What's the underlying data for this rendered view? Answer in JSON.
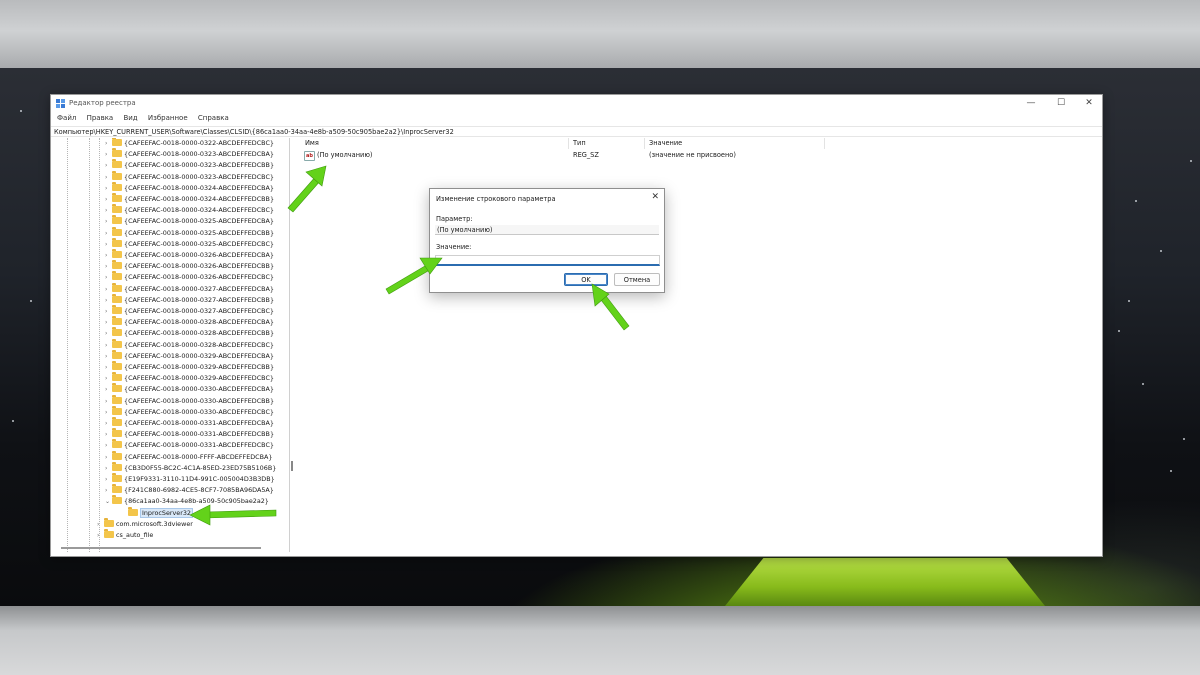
{
  "window": {
    "title": "Редактор реестра",
    "controls": {
      "minimize": "—",
      "maximize": "☐",
      "close": "✕"
    }
  },
  "menu": [
    "Файл",
    "Правка",
    "Вид",
    "Избранное",
    "Справка"
  ],
  "address": "Компьютер\\HKEY_CURRENT_USER\\Software\\Classes\\CLSID\\{86ca1aa0-34aa-4e8b-a509-50c905bae2a2}\\InprocServer32",
  "tree": {
    "items": [
      {
        "label": "{CAFEEFAC-0018-0000-0322-ABCDEFFEDCBC}",
        "level": 2,
        "expander": "›"
      },
      {
        "label": "{CAFEEFAC-0018-0000-0323-ABCDEFFEDCBA}",
        "level": 2,
        "expander": "›"
      },
      {
        "label": "{CAFEEFAC-0018-0000-0323-ABCDEFFEDCBB}",
        "level": 2,
        "expander": "›"
      },
      {
        "label": "{CAFEEFAC-0018-0000-0323-ABCDEFFEDCBC}",
        "level": 2,
        "expander": "›"
      },
      {
        "label": "{CAFEEFAC-0018-0000-0324-ABCDEFFEDCBA}",
        "level": 2,
        "expander": "›"
      },
      {
        "label": "{CAFEEFAC-0018-0000-0324-ABCDEFFEDCBB}",
        "level": 2,
        "expander": "›"
      },
      {
        "label": "{CAFEEFAC-0018-0000-0324-ABCDEFFEDCBC}",
        "level": 2,
        "expander": "›"
      },
      {
        "label": "{CAFEEFAC-0018-0000-0325-ABCDEFFEDCBA}",
        "level": 2,
        "expander": "›"
      },
      {
        "label": "{CAFEEFAC-0018-0000-0325-ABCDEFFEDCBB}",
        "level": 2,
        "expander": "›"
      },
      {
        "label": "{CAFEEFAC-0018-0000-0325-ABCDEFFEDCBC}",
        "level": 2,
        "expander": "›"
      },
      {
        "label": "{CAFEEFAC-0018-0000-0326-ABCDEFFEDCBA}",
        "level": 2,
        "expander": "›"
      },
      {
        "label": "{CAFEEFAC-0018-0000-0326-ABCDEFFEDCBB}",
        "level": 2,
        "expander": "›"
      },
      {
        "label": "{CAFEEFAC-0018-0000-0326-ABCDEFFEDCBC}",
        "level": 2,
        "expander": "›"
      },
      {
        "label": "{CAFEEFAC-0018-0000-0327-ABCDEFFEDCBA}",
        "level": 2,
        "expander": "›"
      },
      {
        "label": "{CAFEEFAC-0018-0000-0327-ABCDEFFEDCBB}",
        "level": 2,
        "expander": "›"
      },
      {
        "label": "{CAFEEFAC-0018-0000-0327-ABCDEFFEDCBC}",
        "level": 2,
        "expander": "›"
      },
      {
        "label": "{CAFEEFAC-0018-0000-0328-ABCDEFFEDCBA}",
        "level": 2,
        "expander": "›"
      },
      {
        "label": "{CAFEEFAC-0018-0000-0328-ABCDEFFEDCBB}",
        "level": 2,
        "expander": "›"
      },
      {
        "label": "{CAFEEFAC-0018-0000-0328-ABCDEFFEDCBC}",
        "level": 2,
        "expander": "›"
      },
      {
        "label": "{CAFEEFAC-0018-0000-0329-ABCDEFFEDCBA}",
        "level": 2,
        "expander": "›"
      },
      {
        "label": "{CAFEEFAC-0018-0000-0329-ABCDEFFEDCBB}",
        "level": 2,
        "expander": "›"
      },
      {
        "label": "{CAFEEFAC-0018-0000-0329-ABCDEFFEDCBC}",
        "level": 2,
        "expander": "›"
      },
      {
        "label": "{CAFEEFAC-0018-0000-0330-ABCDEFFEDCBA}",
        "level": 2,
        "expander": "›"
      },
      {
        "label": "{CAFEEFAC-0018-0000-0330-ABCDEFFEDCBB}",
        "level": 2,
        "expander": "›"
      },
      {
        "label": "{CAFEEFAC-0018-0000-0330-ABCDEFFEDCBC}",
        "level": 2,
        "expander": "›"
      },
      {
        "label": "{CAFEEFAC-0018-0000-0331-ABCDEFFEDCBA}",
        "level": 2,
        "expander": "›"
      },
      {
        "label": "{CAFEEFAC-0018-0000-0331-ABCDEFFEDCBB}",
        "level": 2,
        "expander": "›"
      },
      {
        "label": "{CAFEEFAC-0018-0000-0331-ABCDEFFEDCBC}",
        "level": 2,
        "expander": "›"
      },
      {
        "label": "{CAFEEFAC-0018-0000-FFFF-ABCDEFFEDCBA}",
        "level": 2,
        "expander": "›"
      },
      {
        "label": "{CB3D0F55-BC2C-4C1A-85ED-23ED75B5106B}",
        "level": 2,
        "expander": "›"
      },
      {
        "label": "{E19F9331-3110-11D4-991C-005004D3B3DB}",
        "level": 2,
        "expander": "›"
      },
      {
        "label": "{F241C880-6982-4CE5-8CF7-7085BA96DA5A}",
        "level": 2,
        "expander": "›"
      },
      {
        "label": "{86ca1aa0-34aa-4e8b-a509-50c905bae2a2}",
        "level": 2,
        "expander": "⌄"
      },
      {
        "label": "InprocServer32",
        "level": 3,
        "expander": "",
        "selected": true
      },
      {
        "label": "com.microsoft.3dviewer",
        "level": 1,
        "expander": "›"
      },
      {
        "label": "cs_auto_file",
        "level": 1,
        "expander": "›"
      },
      {
        "label": "",
        "level": 1,
        "expander": ""
      }
    ]
  },
  "values": {
    "columns": [
      "Имя",
      "Тип",
      "Значение"
    ],
    "rows": [
      {
        "icon": "ab",
        "name": "(По умолчанию)",
        "type": "REG_SZ",
        "value": "(значение не присвоено)"
      }
    ]
  },
  "dialog": {
    "title": "Изменение строкового параметра",
    "close": "✕",
    "param_label": "Параметр:",
    "param_value": "(По умолчанию)",
    "value_label": "Значение:",
    "value_text": "",
    "ok": "OK",
    "cancel": "Отмена"
  },
  "colors": {
    "accent": "#2b6cb0",
    "arrow": "#63d21a",
    "folder": "#f3c54a"
  }
}
